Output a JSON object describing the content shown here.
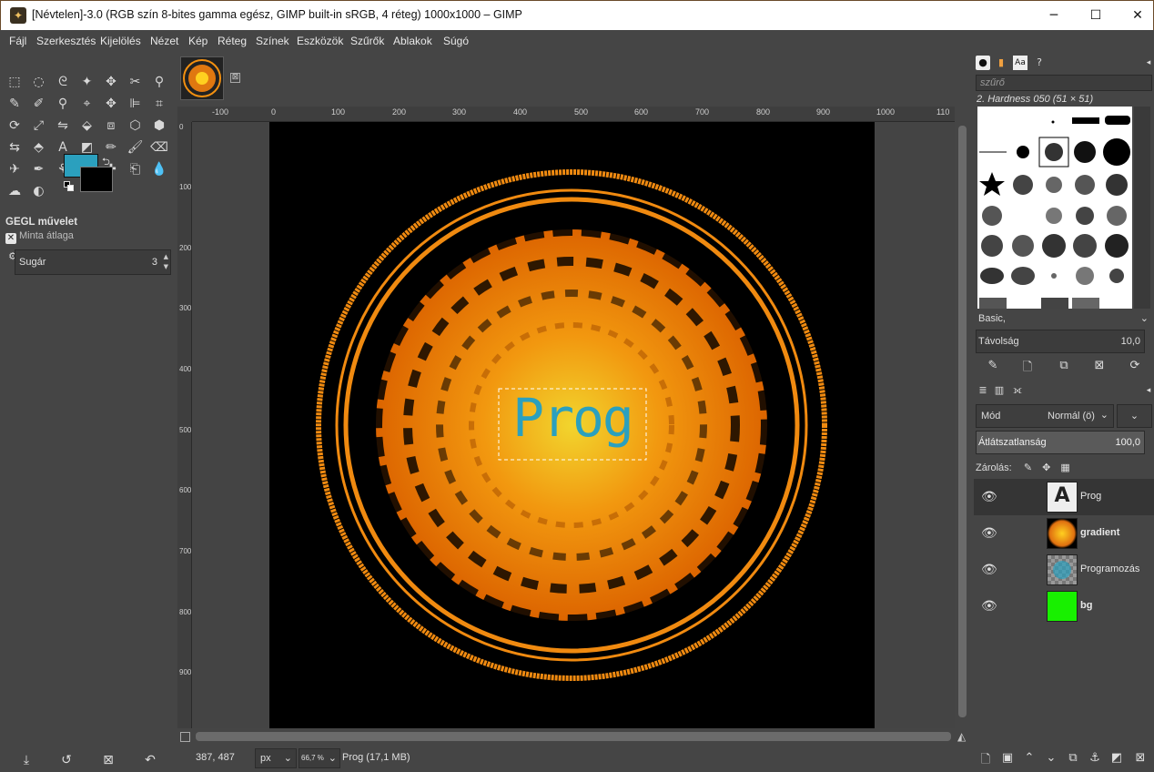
{
  "window": {
    "title": "[Névtelen]-3.0 (RGB szín 8-bites gamma egész, GIMP built-in sRGB, 4 réteg) 1000x1000 – GIMP",
    "controls": [
      "─",
      "☐",
      "✕"
    ]
  },
  "menu": [
    "Fájl",
    "Szerkesztés",
    "Kijelölés",
    "Nézet",
    "Kép",
    "Réteg",
    "Színek",
    "Eszközök",
    "Szűrők",
    "Ablakok",
    "Súgó"
  ],
  "toolbox": {
    "tools": [
      "rect-select-icon",
      "ellipse-select-icon",
      "lasso-icon",
      "fuzzy-select-icon",
      "move-icon",
      "scissors-icon",
      "foreground-select-icon",
      "paths-icon",
      "color-picker-icon",
      "zoom-icon",
      "measure-icon",
      "move-tool-icon",
      "align-icon",
      "crop-icon",
      "rotate-icon",
      "scale-icon",
      "shear-icon",
      "perspective-icon",
      "unified-transform-icon",
      "cage-icon",
      "warp-icon",
      "flip-icon",
      "bucket-fill-icon",
      "text-icon",
      "gradient-icon",
      "pencil-icon",
      "paintbrush-icon",
      "eraser-icon",
      "airbrush-icon",
      "ink-icon",
      "mypaint-icon",
      "clone-icon",
      "heal-icon",
      "perspective-clone-icon",
      "blur-icon",
      "smudge-icon",
      "dodge-icon"
    ],
    "glyphs": [
      "⬚",
      "◌",
      "ᘓ",
      "✦",
      "✥",
      "✂",
      "⚲",
      "✎",
      "✐",
      "⚲",
      "⌖",
      "✥",
      "⊫",
      "⌗",
      "⟳",
      "⤢",
      "⇋",
      "⬙",
      "⧈",
      "⬡",
      "⬢",
      "⇆",
      "⬘",
      "A",
      "◩",
      "✏",
      "🖌",
      "⌫",
      "✈",
      "✒",
      "⚘",
      "⎘",
      "✚",
      "⎗",
      "💧",
      "☁",
      "◐"
    ],
    "fg_color": "#2ba0be",
    "bg_color": "#000000"
  },
  "tool_options": {
    "title": "GEGL művelet",
    "operation": "Minta átlaga",
    "param_label": "Sugár",
    "param_value": "3"
  },
  "image_tab": {
    "close": "⊠"
  },
  "ruler": {
    "h_labels": [
      "-100",
      "0",
      "100",
      "200",
      "300",
      "400",
      "500",
      "600",
      "700",
      "800",
      "900",
      "1000",
      "110"
    ],
    "v_labels": [
      "0",
      "100",
      "200",
      "300",
      "400",
      "500",
      "600",
      "700",
      "800",
      "900"
    ]
  },
  "canvas": {
    "text_layer": "Prog",
    "text_color": "#2ba0be"
  },
  "status": {
    "coords": "387, 487",
    "unit": "px",
    "zoom": "66,7 %",
    "layer_info": "Prog (17,1 MB)"
  },
  "brushes": {
    "filter_placeholder": "szűrő",
    "current": "2. Hardness 050 (51 × 51)",
    "preset": "Basic,",
    "spacing_label": "Távolság",
    "spacing_value": "10,0"
  },
  "layers": {
    "mode_label": "Mód",
    "mode_value": "Normál (ö)",
    "opacity_label": "Átlátszatlanság",
    "opacity_value": "100,0",
    "lock_label": "Zárolás:",
    "items": [
      {
        "name": "Prog",
        "thumb": "text"
      },
      {
        "name": "gradient",
        "thumb": "gradient"
      },
      {
        "name": "Programozás",
        "thumb": "transparent"
      },
      {
        "name": "bg",
        "thumb": "green"
      }
    ]
  }
}
